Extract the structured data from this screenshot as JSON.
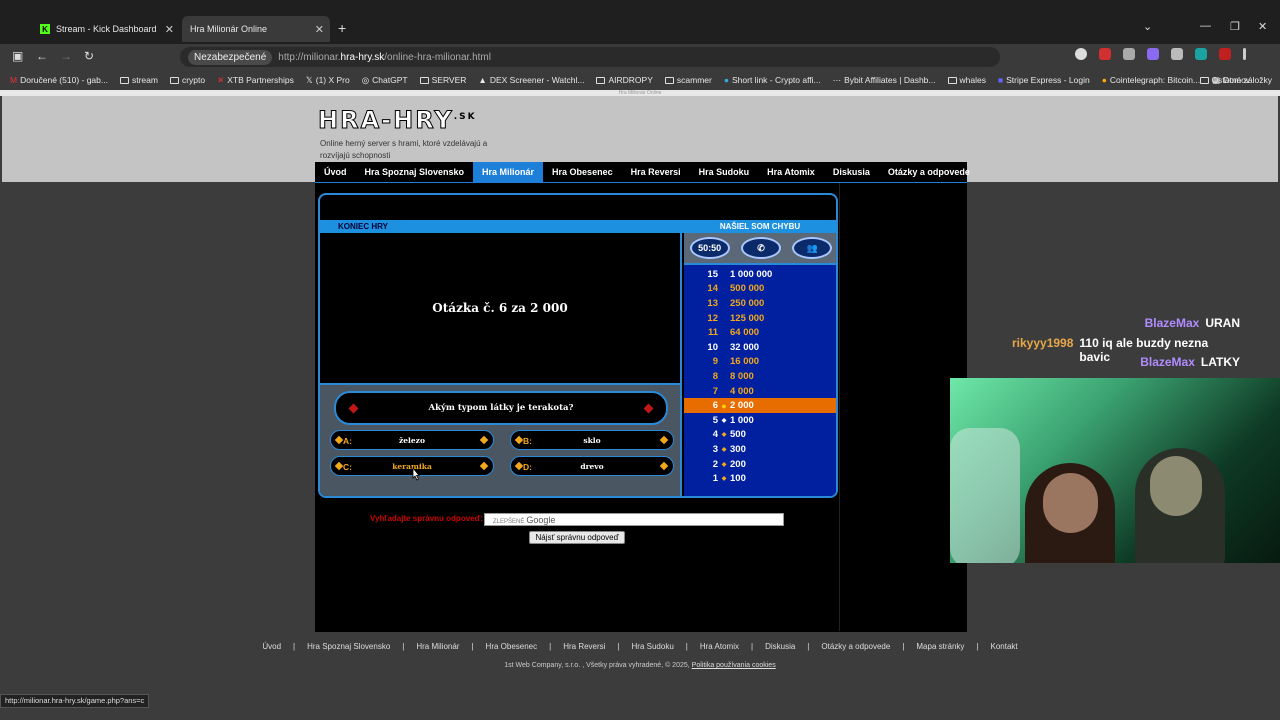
{
  "browser": {
    "tabs": [
      {
        "title": "Stream - Kick Dashboard"
      },
      {
        "title": "Hra Milionár Online"
      }
    ],
    "security_label": "Nezabezpečené",
    "url_prefix": "http://milionar.",
    "url_domain": "hra-hry.sk",
    "url_suffix": "/online-hra-milionar.html",
    "bookmarks": [
      "Doručené (510) - gab...",
      "stream",
      "crypto",
      "XTB Partnerships",
      "(1) X Pro",
      "ChatGPT",
      "SERVER",
      "DEX Screener - Watchl...",
      "AIRDROPY",
      "scammer",
      "Short link - Crypto affi...",
      "Bybit Affiliates | Dashb...",
      "whales",
      "Stripe Express - Login",
      "Cointelegraph: Bitcoin...",
      "Domov"
    ],
    "bookmarks_other": "Ostatné záložky",
    "status_url": "http://milionar.hra-hry.sk/game.php?ans=c"
  },
  "site": {
    "top_strip": "Hra Milionár Online",
    "logo": "HRA-HRY",
    "logo_tld": ".SK",
    "slogan": "Online herný server s hrami, ktoré vzdelávajú a rozvíjajú schopnosti",
    "menu": [
      "Úvod",
      "Hra Spoznaj Slovensko",
      "Hra Milionár",
      "Hra Obesenec",
      "Hra Reversi",
      "Hra Sudoku",
      "Hra Atomix",
      "Diskusia",
      "Otázky a odpovede"
    ],
    "menu_active": 2
  },
  "game": {
    "end_label": "KONIEC HRY",
    "bug_label": "NAŠIEL SOM CHYBU",
    "question_header": "Otázka č. 6 za 2 000",
    "question": "Akým typom látky je terakota?",
    "answers": [
      {
        "letter": "A:",
        "text": "železo"
      },
      {
        "letter": "B:",
        "text": "sklo"
      },
      {
        "letter": "C:",
        "text": "keramika"
      },
      {
        "letter": "D:",
        "text": "drevo"
      }
    ],
    "lifelines": {
      "fifty": "50:50"
    },
    "ladder": [
      {
        "n": "15",
        "v": "1 000 000"
      },
      {
        "n": "14",
        "v": "500 000"
      },
      {
        "n": "13",
        "v": "250 000"
      },
      {
        "n": "12",
        "v": "125 000"
      },
      {
        "n": "11",
        "v": "64 000"
      },
      {
        "n": "10",
        "v": "32 000"
      },
      {
        "n": "9",
        "v": "16 000"
      },
      {
        "n": "8",
        "v": "8 000"
      },
      {
        "n": "7",
        "v": "4 000"
      },
      {
        "n": "6",
        "v": "2 000"
      },
      {
        "n": "5",
        "v": "1 000"
      },
      {
        "n": "4",
        "v": "500"
      },
      {
        "n": "3",
        "v": "300"
      },
      {
        "n": "2",
        "v": "200"
      },
      {
        "n": "1",
        "v": "100"
      }
    ],
    "current_level": "6"
  },
  "search": {
    "label": "Vyhľadajte správnu odpoveď:",
    "placeholder_small": "ZLEPŠENÉ",
    "placeholder_google": "Google",
    "button": "Nájsť správnu odpoveď"
  },
  "footer": {
    "links": [
      "Úvod",
      "Hra Spoznaj Slovensko",
      "Hra Milionár",
      "Hra Obesenec",
      "Hra Reversi",
      "Hra Sudoku",
      "Hra Atomix",
      "Diskusia",
      "Otázky a odpovede",
      "Mapa stránky",
      "Kontakt"
    ],
    "copyright": "1st Web Company, s.r.o. , Všetky práva vyhradené, © 2025,",
    "cookies": "Politika používania cookies"
  },
  "chat": [
    {
      "user": "BlazeMax",
      "color": "#b18cff",
      "msg": "URAN"
    },
    {
      "user": "rikyyy1998",
      "color": "#e8a84a",
      "msg": "110 iq ale buzdy nezna bavic"
    },
    {
      "user": "BlazeMax",
      "color": "#b18cff",
      "msg": "LATKY"
    }
  ]
}
